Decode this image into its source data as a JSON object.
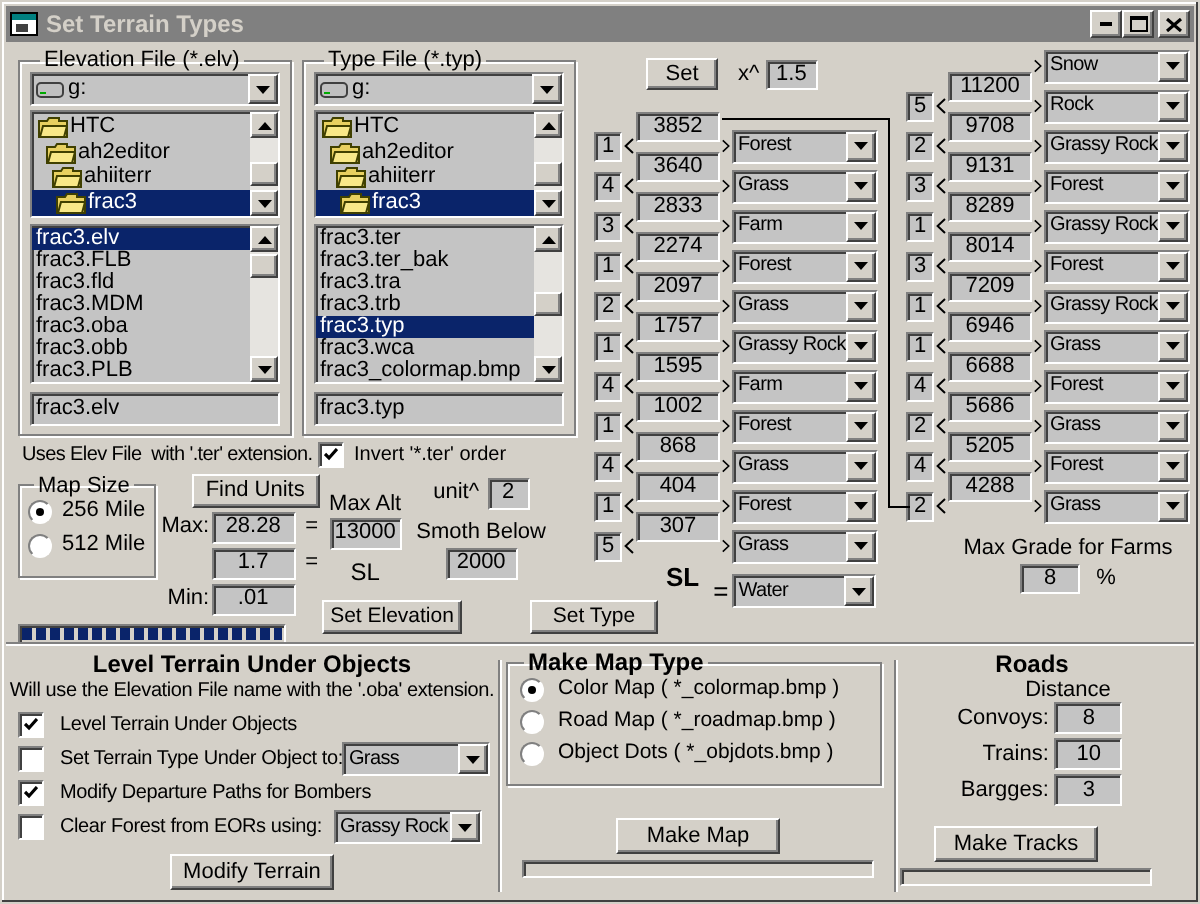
{
  "window": {
    "title": "Set Terrain Types"
  },
  "elevation_file": {
    "label": "Elevation File (*.elv)",
    "drive": "g:",
    "folders": [
      {
        "name": "HTC",
        "selected": false,
        "children": [
          {
            "name": "ah2editor",
            "selected": false,
            "children": [
              {
                "name": "ahiiterr",
                "selected": false,
                "children": [
                  {
                    "name": "frac3",
                    "selected": true
                  }
                ]
              }
            ]
          }
        ]
      }
    ],
    "files": [
      {
        "name": "frac3.elv",
        "selected": true
      },
      {
        "name": "frac3.FLB",
        "selected": false
      },
      {
        "name": "frac3.fld",
        "selected": false
      },
      {
        "name": "frac3.MDM",
        "selected": false
      },
      {
        "name": "frac3.oba",
        "selected": false
      },
      {
        "name": "frac3.obb",
        "selected": false
      },
      {
        "name": "frac3.PLB",
        "selected": false
      }
    ],
    "filename": "frac3.elv"
  },
  "type_file": {
    "label": "Type File (*.typ)",
    "drive": "g:",
    "folders": [
      {
        "name": "HTC",
        "selected": false,
        "children": [
          {
            "name": "ah2editor",
            "selected": false,
            "children": [
              {
                "name": "ahiiterr",
                "selected": false,
                "children": [
                  {
                    "name": "frac3",
                    "selected": true
                  }
                ]
              }
            ]
          }
        ]
      }
    ],
    "files": [
      {
        "name": "frac3.ter",
        "selected": false
      },
      {
        "name": "frac3.ter_bak",
        "selected": false
      },
      {
        "name": "frac3.tra",
        "selected": false
      },
      {
        "name": "frac3.trb",
        "selected": false
      },
      {
        "name": "frac3.typ",
        "selected": true
      },
      {
        "name": "frac3.wca",
        "selected": false
      },
      {
        "name": "frac3_colormap.bmp",
        "selected": false
      }
    ],
    "filename": "frac3.typ"
  },
  "uses_note": "Uses Elev File  with '.ter' extension.",
  "invert_order": {
    "label": "Invert '*.ter' order",
    "checked": true
  },
  "map_size": {
    "label": "Map Size",
    "options": [
      {
        "label": "256 Mile",
        "selected": true
      },
      {
        "label": "512 Mile",
        "selected": false
      }
    ]
  },
  "find_units": "Find Units",
  "max": {
    "label": "Max:",
    "value": "28.28",
    "equals": "="
  },
  "sea_level_value": {
    "value": "1.7",
    "equals": "="
  },
  "min": {
    "label": "Min:",
    "value": ".01"
  },
  "max_alt": {
    "label": "Max Alt",
    "value": "13000"
  },
  "sl_label": "SL",
  "unit": {
    "label": "unit^",
    "value": "2"
  },
  "smooth_below": {
    "label": "Smoth Below",
    "value": "2000"
  },
  "progress": {
    "level": 1
  },
  "set_elevation": "Set Elevation",
  "set_type": "Set Type",
  "exponent": {
    "button": "Set",
    "label": "x^",
    "value": "1.5"
  },
  "low_band": [
    {
      "threshold": "3852",
      "count": "1",
      "type": "Forest"
    },
    {
      "threshold": "3640",
      "count": "4",
      "type": "Grass"
    },
    {
      "threshold": "2833",
      "count": "3",
      "type": "Farm"
    },
    {
      "threshold": "2274",
      "count": "1",
      "type": "Forest"
    },
    {
      "threshold": "2097",
      "count": "2",
      "type": "Grass"
    },
    {
      "threshold": "1757",
      "count": "1",
      "type": "Grassy Rock"
    },
    {
      "threshold": "1595",
      "count": "4",
      "type": "Farm"
    },
    {
      "threshold": "1002",
      "count": "1",
      "type": "Forest"
    },
    {
      "threshold": "868",
      "count": "4",
      "type": "Grass"
    },
    {
      "threshold": "404",
      "count": "1",
      "type": "Forest"
    },
    {
      "threshold": "307",
      "count": "5",
      "type": "Grass"
    }
  ],
  "sea_level": {
    "label": "SL",
    "equals": "=",
    "type": "Water"
  },
  "high_band": {
    "top_type": "Snow",
    "rows": [
      {
        "threshold": "11200",
        "count": "5",
        "type": "Rock"
      },
      {
        "threshold": "9708",
        "count": "2",
        "type": "Grassy Rock"
      },
      {
        "threshold": "9131",
        "count": "3",
        "type": "Forest"
      },
      {
        "threshold": "8289",
        "count": "1",
        "type": "Grassy Rock"
      },
      {
        "threshold": "8014",
        "count": "3",
        "type": "Forest"
      },
      {
        "threshold": "7209",
        "count": "1",
        "type": "Grassy Rock"
      },
      {
        "threshold": "6946",
        "count": "1",
        "type": "Grass"
      },
      {
        "threshold": "6688",
        "count": "4",
        "type": "Forest"
      },
      {
        "threshold": "5686",
        "count": "2",
        "type": "Grass"
      },
      {
        "threshold": "5205",
        "count": "4",
        "type": "Forest"
      },
      {
        "threshold": "4288",
        "count": "2",
        "type": "Grass"
      }
    ]
  },
  "max_grade": {
    "label": "Max Grade for Farms",
    "value": "8",
    "unit": "%"
  },
  "level_terrain": {
    "title": "Level Terrain Under Objects",
    "note": "Will use the Elevation File name with the '.oba' extension.",
    "options": [
      {
        "kind": "check",
        "label": "Level Terrain Under Objects",
        "checked": true
      },
      {
        "kind": "check-select",
        "label": "Set Terrain Type Under Object to:",
        "checked": false,
        "value": "Grass"
      },
      {
        "kind": "check",
        "label": "Modify Departure Paths for Bombers",
        "checked": true
      },
      {
        "kind": "check-select",
        "label": "Clear Forest from EORs using:",
        "checked": false,
        "value": "Grassy Rock"
      }
    ],
    "button": "Modify Terrain"
  },
  "make_map": {
    "title": "Make Map Type",
    "options": [
      {
        "label": "Color Map ( *_colormap.bmp )",
        "selected": true
      },
      {
        "label": "Road Map ( *_roadmap.bmp )",
        "selected": false
      },
      {
        "label": "Object Dots ( *_objdots.bmp )",
        "selected": false
      }
    ],
    "button": "Make Map",
    "progress": {
      "level": 0
    }
  },
  "roads": {
    "title": "Roads",
    "distance_label": "Distance",
    "rows": [
      {
        "label": "Convoys:",
        "value": "8"
      },
      {
        "label": "Trains:",
        "value": "10"
      },
      {
        "label": "Bargges:",
        "value": "3"
      }
    ],
    "button": "Make Tracks",
    "progress": {
      "level": 0
    }
  }
}
